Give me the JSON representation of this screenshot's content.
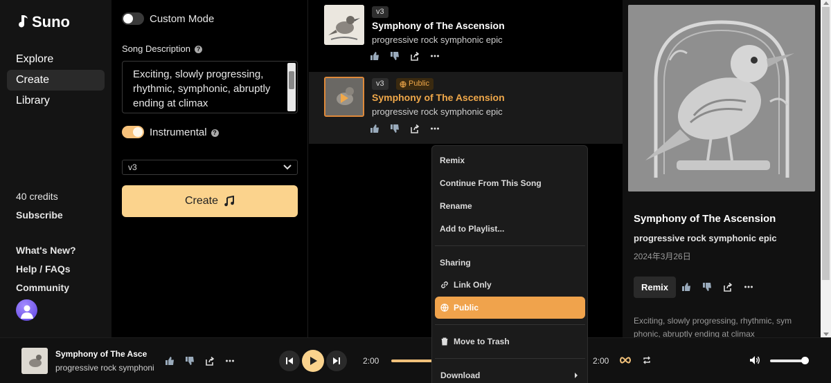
{
  "app": {
    "name": "Suno"
  },
  "sidebar": {
    "nav": [
      {
        "label": "Explore",
        "active": false
      },
      {
        "label": "Create",
        "active": true
      },
      {
        "label": "Library",
        "active": false
      }
    ],
    "credits": "40 credits",
    "subscribe": "Subscribe",
    "links": [
      "What's New?",
      "Help / FAQs",
      "Community"
    ]
  },
  "create": {
    "custom_mode_label": "Custom Mode",
    "custom_mode_on": false,
    "song_description_label": "Song Description",
    "song_description_value": "Exciting, slowly progressing, rhythmic, symphonic, abruptly ending at climax",
    "instrumental_label": "Instrumental",
    "instrumental_on": true,
    "model_selected": "v3",
    "create_button_label": "Create"
  },
  "songs": [
    {
      "version": "v3",
      "public_label": "",
      "title": "Symphony of The Ascension",
      "tags": "progressive rock symphonic epic",
      "playing": false
    },
    {
      "version": "v3",
      "public_label": "Public",
      "title": "Symphony of The Ascension",
      "tags": "progressive rock symphonic epic",
      "playing": true
    }
  ],
  "context_menu": {
    "items_top": [
      "Remix",
      "Continue From This Song",
      "Rename",
      "Add to Playlist..."
    ],
    "sharing_header": "Sharing",
    "link_only": "Link Only",
    "public": "Public",
    "move_to_trash": "Move to Trash",
    "download": "Download"
  },
  "detail": {
    "title": "Symphony of The Ascension",
    "tags": "progressive rock symphonic epic",
    "date": "2024年3月26日",
    "remix_label": "Remix",
    "description": "Exciting, slowly progressing, rhythmic, sym phonic, abruptly ending at climax"
  },
  "player": {
    "title": "Symphony of The Asce",
    "subtitle": "progressive rock symphoni",
    "elapsed": "2:00",
    "duration": "2:00"
  },
  "colors": {
    "accent": "#fbd38d",
    "playing": "#f0a84a",
    "menu_highlight": "#f0a34c"
  }
}
